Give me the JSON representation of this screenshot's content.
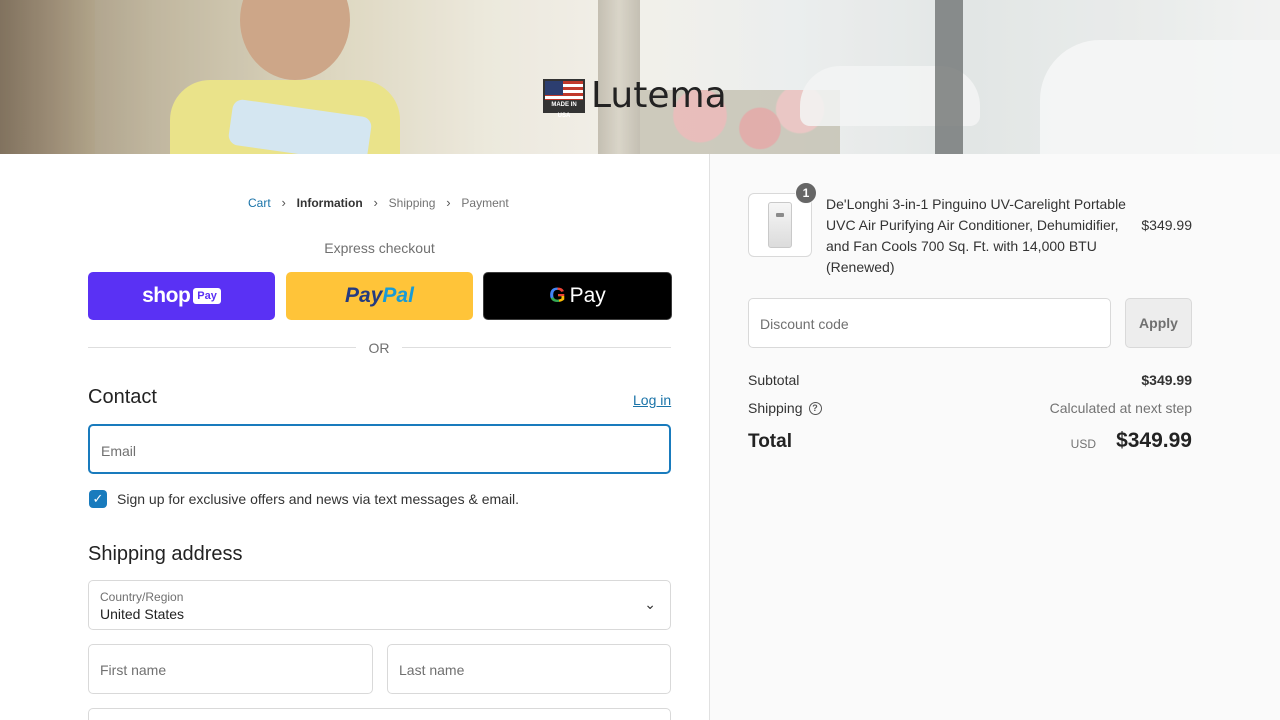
{
  "banner": {
    "logo_badge": "MADE IN USA",
    "logo_text": "Lutema"
  },
  "breadcrumb": [
    {
      "label": "Cart"
    },
    {
      "label": "Information"
    },
    {
      "label": "Shipping"
    },
    {
      "label": "Payment"
    }
  ],
  "express": {
    "heading": "Express checkout",
    "shop_label": "shop",
    "shop_pay_tag": "Pay",
    "paypal_part1": "Pay",
    "paypal_part2": "Pal",
    "gpay_g": "G",
    "gpay_label": "Pay",
    "or_text": "OR"
  },
  "contact": {
    "title": "Contact",
    "login_link": "Log in",
    "email_placeholder": "Email",
    "checkbox_checked": true,
    "checkbox_label": "Sign up for exclusive offers and news via text messages & email."
  },
  "shipping_address": {
    "title": "Shipping address",
    "country_caption": "Country/Region",
    "country_value": "United States",
    "first_name_placeholder": "First name",
    "last_name_placeholder": "Last name"
  },
  "order_summary": {
    "quantity_badge": "1",
    "product_name": "De'Longhi 3-in-1 Pinguino UV-Carelight Portable UVC Air Purifying Air Conditioner, Dehumidifier, and Fan Cools 700 Sq. Ft. with 14,000 BTU (Renewed)",
    "product_price": "$349.99",
    "discount_placeholder": "Discount code",
    "apply_label": "Apply",
    "subtotal_label": "Subtotal",
    "subtotal_value": "$349.99",
    "shipping_label": "Shipping",
    "shipping_value": "Calculated at next step",
    "total_label": "Total",
    "total_currency": "USD",
    "total_value": "$349.99"
  },
  "colors": {
    "link_blue": "#1a73a8",
    "shop_pay_purple": "#5a31f4",
    "paypal_yellow": "#ffc439",
    "gpay_black": "#000000",
    "focus_blue": "#197bbd"
  },
  "icons": [
    "chevron-right-icon",
    "checkmark-icon",
    "chevron-down-icon",
    "help-circle-icon",
    "made-in-usa-flag-icon"
  ]
}
